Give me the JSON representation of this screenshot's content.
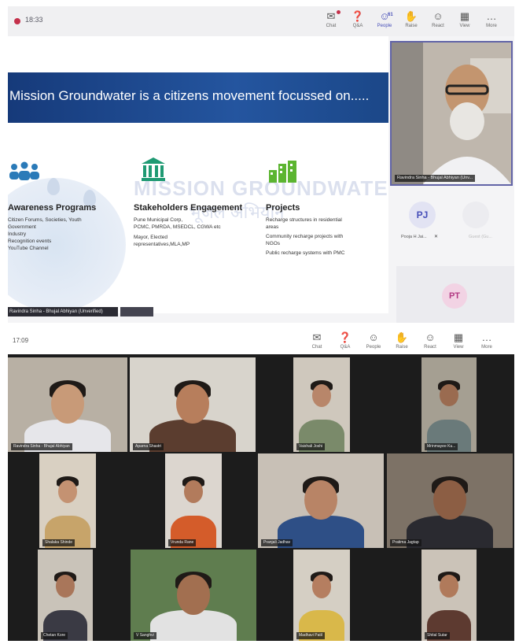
{
  "top": {
    "timer": "18:33",
    "toolbar": [
      {
        "label": "Chat",
        "icon": "chat-icon",
        "glyph": "✉"
      },
      {
        "label": "Q&A",
        "icon": "qa-icon",
        "glyph": "❓"
      },
      {
        "label": "People",
        "icon": "people-icon",
        "glyph": "☺",
        "count": "61"
      },
      {
        "label": "Raise",
        "icon": "raise-hand-icon",
        "glyph": "✋"
      },
      {
        "label": "React",
        "icon": "react-icon",
        "glyph": "☺"
      },
      {
        "label": "View",
        "icon": "view-icon",
        "glyph": "▦"
      },
      {
        "label": "More",
        "icon": "more-icon",
        "glyph": "…"
      }
    ],
    "slide": {
      "title": "Mission Groundwater is a citizens movement  focussed on.....",
      "watermark": "MISSION GROUNDWATER",
      "watermark_hindi": "भूजल अभियान",
      "columns": [
        {
          "title": "Awareness Programs",
          "lines": [
            "Citizen Forums, Societies, Youth",
            "Government",
            "Industry",
            "Recognition events",
            "YouTube Channel"
          ]
        },
        {
          "title": "Stakeholders Engagement",
          "lines": [
            "Pune Municipal Corp,",
            "PCMC, PMRDA, MSEDCL, CGWA etc",
            "Mayor, Elected",
            "representatives,MLA,MP"
          ]
        },
        {
          "title": "Projects",
          "lines": [
            "Recharge structures in residential",
            "areas",
            "Community recharge projects with",
            "NGOs",
            "Public recharge systems with PMC"
          ]
        }
      ],
      "presenter_label": "Ravindra Sinha - Bhujal Abhiyan (Unverified)"
    },
    "participants": {
      "main_video_name": "Ravindra Sinha - Bhujal Abhiyan (Unv...",
      "pj_initials": "PJ",
      "pj_name": "Pooja H Jai...",
      "gray_name": "Guest (Gu...",
      "pt_initials": "PT"
    }
  },
  "bottom": {
    "timer": "17:09",
    "toolbar": [
      {
        "label": "Chat",
        "icon": "chat-icon",
        "glyph": "✉"
      },
      {
        "label": "Q&A",
        "icon": "qa-icon",
        "glyph": "❓"
      },
      {
        "label": "People",
        "icon": "people-icon",
        "glyph": "☺"
      },
      {
        "label": "Raise",
        "icon": "raise-hand-icon",
        "glyph": "✋"
      },
      {
        "label": "React",
        "icon": "react-icon",
        "glyph": "☺"
      },
      {
        "label": "View",
        "icon": "view-icon",
        "glyph": "▦"
      },
      {
        "label": "More",
        "icon": "more-icon",
        "glyph": "…"
      }
    ],
    "tiles": [
      {
        "name": "Ravindra Sinha - Bhujal Abhiyan",
        "bg": "#b8b0a4",
        "skin": "#c89a78",
        "shirt": "#e6e6ea"
      },
      {
        "name": "Aparna Shastri",
        "bg": "#d8d4cc",
        "skin": "#b77e5c",
        "shirt": "#5b3d2f"
      },
      {
        "name": "Vaishali Joshi",
        "bg": "#cfc8bd",
        "skin": "#b8866a",
        "shirt": "#7a8a6a"
      },
      {
        "name": "Mrinmayee Ku...",
        "bg": "#a59f92",
        "skin": "#9a6b50",
        "shirt": "#6a7a7a"
      },
      {
        "name": "Shalaka Shinde",
        "bg": "#d9d0c2",
        "skin": "#c49272",
        "shirt": "#c7a46a"
      },
      {
        "name": "Vrunda Rane",
        "bg": "#dcd6cf",
        "skin": "#b27b5c",
        "shirt": "#d45c2a"
      },
      {
        "name": "Pranjali Jadhav",
        "bg": "#c8c0b6",
        "skin": "#b88466",
        "shirt": "#2e4f86"
      },
      {
        "name": "Pratima Jagtap",
        "bg": "#7d7266",
        "skin": "#8c5e44",
        "shirt": "#2a2a30"
      },
      {
        "name": "Chetan Kore",
        "bg": "#c9c3b9",
        "skin": "#a9765a",
        "shirt": "#3a3a44"
      },
      {
        "name": "V Sanghvi",
        "bg": "#5f7d4f",
        "skin": "#a26f50",
        "shirt": "#e2e2e2"
      },
      {
        "name": "Madhavi Patil",
        "bg": "#d5cfc4",
        "skin": "#b57e60",
        "shirt": "#d9b84a"
      },
      {
        "name": "Shital Sutar",
        "bg": "#cbc3b8",
        "skin": "#b07a5b",
        "shirt": "#5d3a30"
      }
    ]
  }
}
